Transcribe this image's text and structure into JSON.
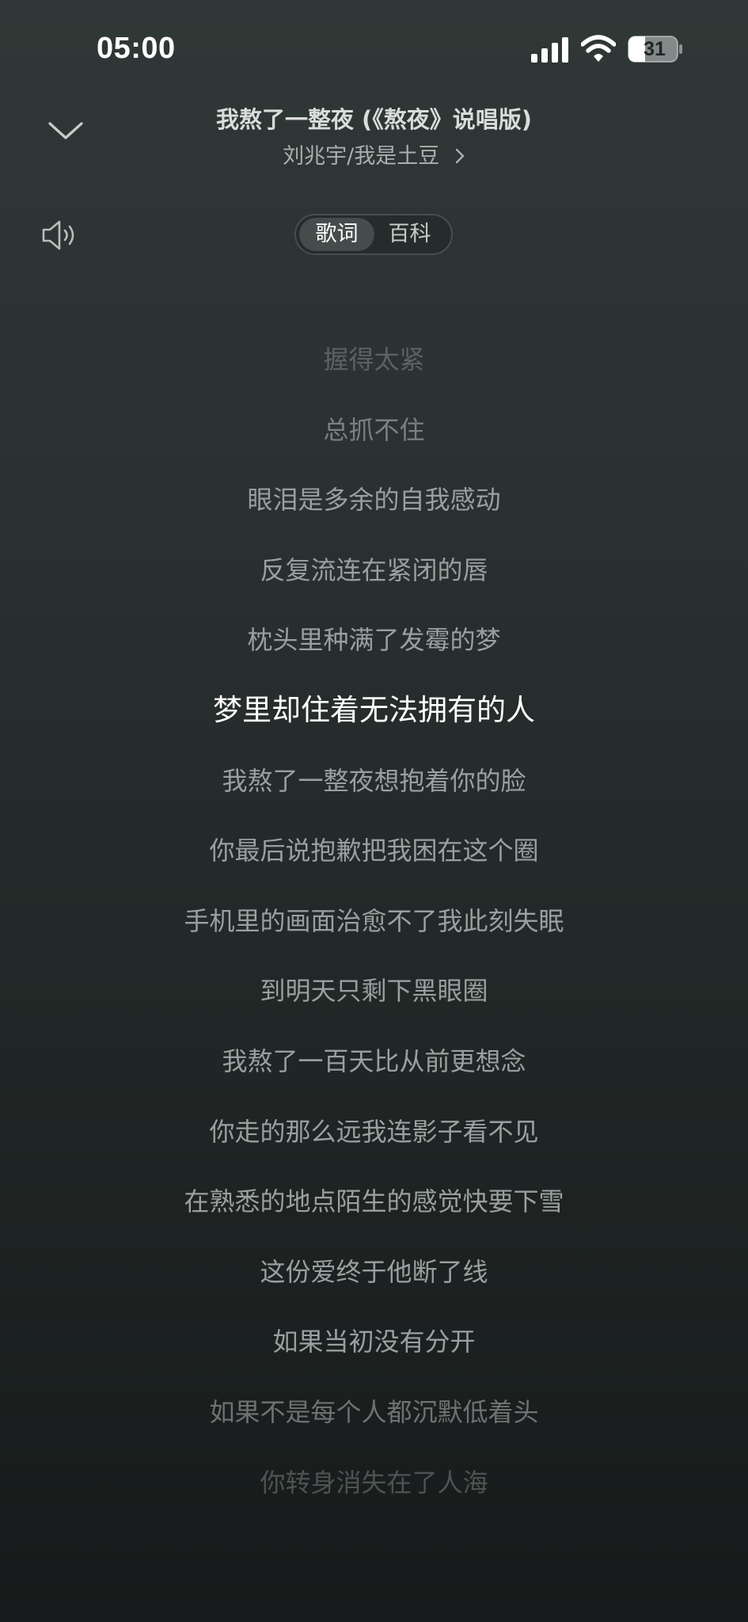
{
  "status_bar": {
    "time": "05:00",
    "battery": "31",
    "icons": [
      "signal-icon",
      "wifi-icon",
      "battery-icon"
    ]
  },
  "header": {
    "title": "我熬了一整夜 (《熬夜》说唱版)",
    "artists": "刘兆宇/我是土豆",
    "collapse_icon": "chevron-down-icon",
    "artist_icon": "chevron-right-icon"
  },
  "controls": {
    "volume_icon": "speaker-icon",
    "tabs": [
      {
        "label": "歌词",
        "selected": true
      },
      {
        "label": "百科",
        "selected": false
      }
    ]
  },
  "lyrics": {
    "active_index": 5,
    "lines": [
      "握得太紧",
      "总抓不住",
      "眼泪是多余的自我感动",
      "反复流连在紧闭的唇",
      "枕头里种满了发霉的梦",
      "梦里却住着无法拥有的人",
      "我熬了一整夜想抱着你的脸",
      "你最后说抱歉把我困在这个圈",
      "手机里的画面治愈不了我此刻失眠",
      "到明天只剩下黑眼圈",
      "我熬了一百天比从前更想念",
      "你走的那么远我连影子看不见",
      "在熟悉的地点陌生的感觉快要下雪",
      "这份爱终于他断了线",
      "如果当初没有分开",
      "如果不是每个人都沉默低着头",
      "你转身消失在了人海"
    ]
  },
  "colors": {
    "background_top": "#303837",
    "background_bottom": "#161a1a",
    "active_lyric": "#ffffff",
    "inactive_lyric": "#9aa09f"
  }
}
